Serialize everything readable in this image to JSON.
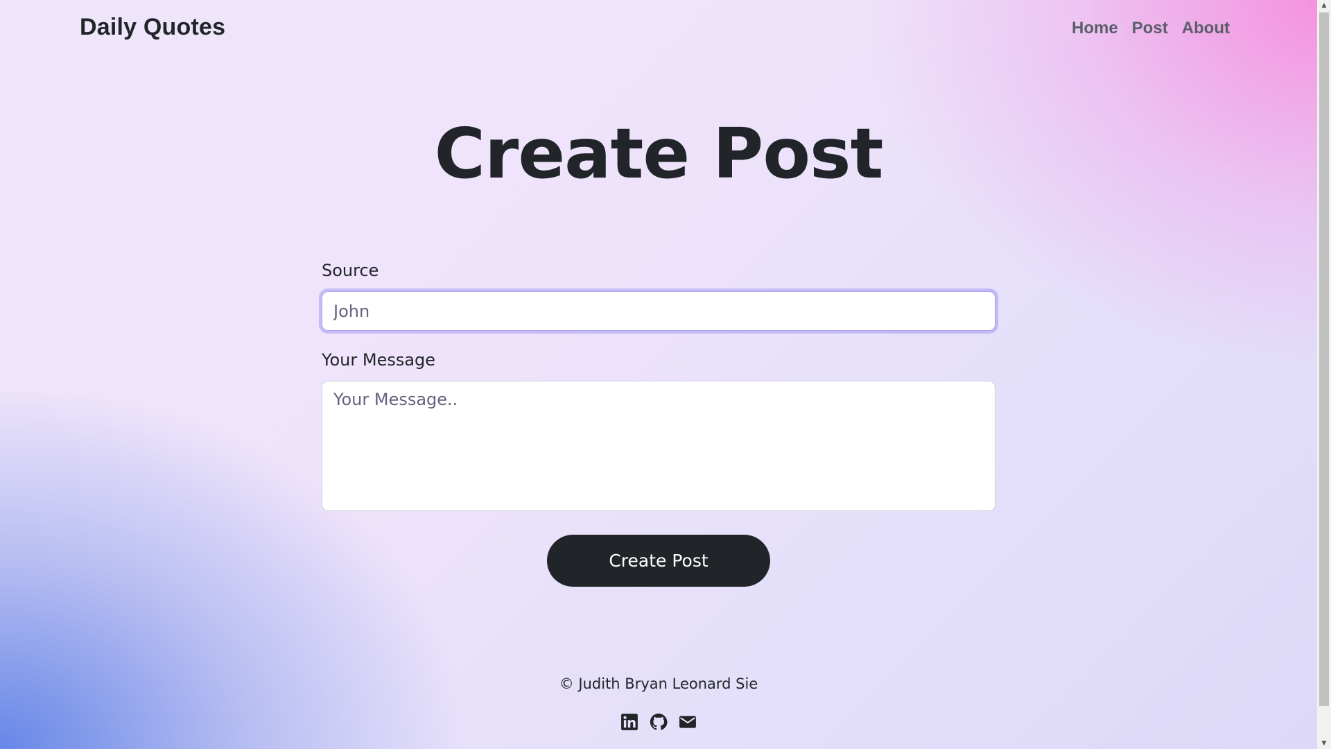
{
  "navbar": {
    "brand": "Daily Quotes",
    "links": [
      "Home",
      "Post",
      "About"
    ]
  },
  "header": {
    "title": "Create Post"
  },
  "form": {
    "source_label": "Source",
    "source_placeholder": "John",
    "message_label": "Your Message",
    "message_placeholder": "Your Message..",
    "submit_label": "Create Post"
  },
  "footer": {
    "copyright": "© Judith Bryan Leonard Sie",
    "socials": [
      "linkedin-icon",
      "github-icon",
      "envelope-icon"
    ]
  },
  "colors": {
    "text_dark": "#212529",
    "nav_link": "#5a5f6a",
    "button_bg": "#212529",
    "gradient_pink": "#f68cdc",
    "gradient_blue": "#5f82e6",
    "gradient_lavender": "#efe6fb"
  }
}
